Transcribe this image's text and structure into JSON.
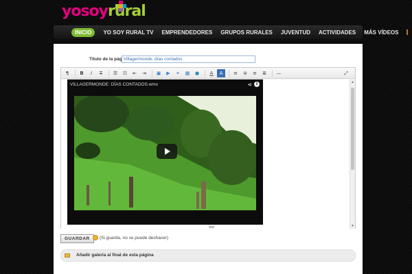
{
  "logo": {
    "part1": "yo",
    "part2": "soy",
    "part3": "rural",
    "colors": {
      "pink": "#e5007e",
      "green": "#a6ce39"
    }
  },
  "nav": {
    "items": [
      {
        "label": "INICIO",
        "active": true
      },
      {
        "label": "YO SOY RURAL TV"
      },
      {
        "label": "EMPRENDEDORES"
      },
      {
        "label": "GRUPOS RURALES"
      },
      {
        "label": "JUVENTUD"
      },
      {
        "label": "ACTIVIDADES"
      },
      {
        "label": "MÁS VÍDEOS"
      }
    ],
    "accent": "#7cbc30"
  },
  "form": {
    "title_label": "Título de la página:",
    "title_value": "Villagermonde, días contados"
  },
  "toolbar": {
    "icons": [
      "paragraph-icon",
      "bold-icon",
      "italic-icon",
      "strikethrough-icon",
      "bulleted-list-icon",
      "numbered-list-icon",
      "outdent-icon",
      "indent-icon",
      "image-icon",
      "video-icon",
      "link-icon",
      "table-icon",
      "special-char-icon",
      "text-color-icon",
      "text-background-icon",
      "align-left-icon",
      "align-center-icon",
      "align-right-icon",
      "align-justify-icon",
      "horizontal-rule-icon",
      "fullscreen-icon"
    ]
  },
  "video": {
    "title": "VILLAGERMONDE: DÍAS CONTADOS.wmv"
  },
  "save": {
    "button_label": "GUARDAR",
    "note": "(Si guarda, no se puede deshacer)"
  },
  "gallery": {
    "label": "Añadir galería al final de esta página"
  }
}
